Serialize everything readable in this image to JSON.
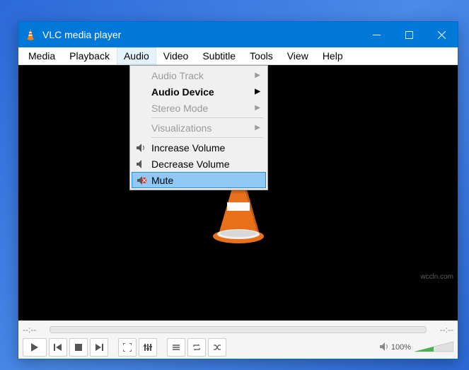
{
  "window": {
    "title": "VLC media player"
  },
  "menubar": {
    "items": [
      "Media",
      "Playback",
      "Audio",
      "Video",
      "Subtitle",
      "Tools",
      "View",
      "Help"
    ],
    "active_index": 2
  },
  "audio_menu": {
    "audio_track": "Audio Track",
    "audio_device": "Audio Device",
    "stereo_mode": "Stereo Mode",
    "visualizations": "Visualizations",
    "increase_volume": "Increase Volume",
    "decrease_volume": "Decrease Volume",
    "mute": "Mute"
  },
  "playback": {
    "time_elapsed": "--:--",
    "time_total": "--:--",
    "volume_percent": "100%"
  },
  "watermark": "wccln.com"
}
